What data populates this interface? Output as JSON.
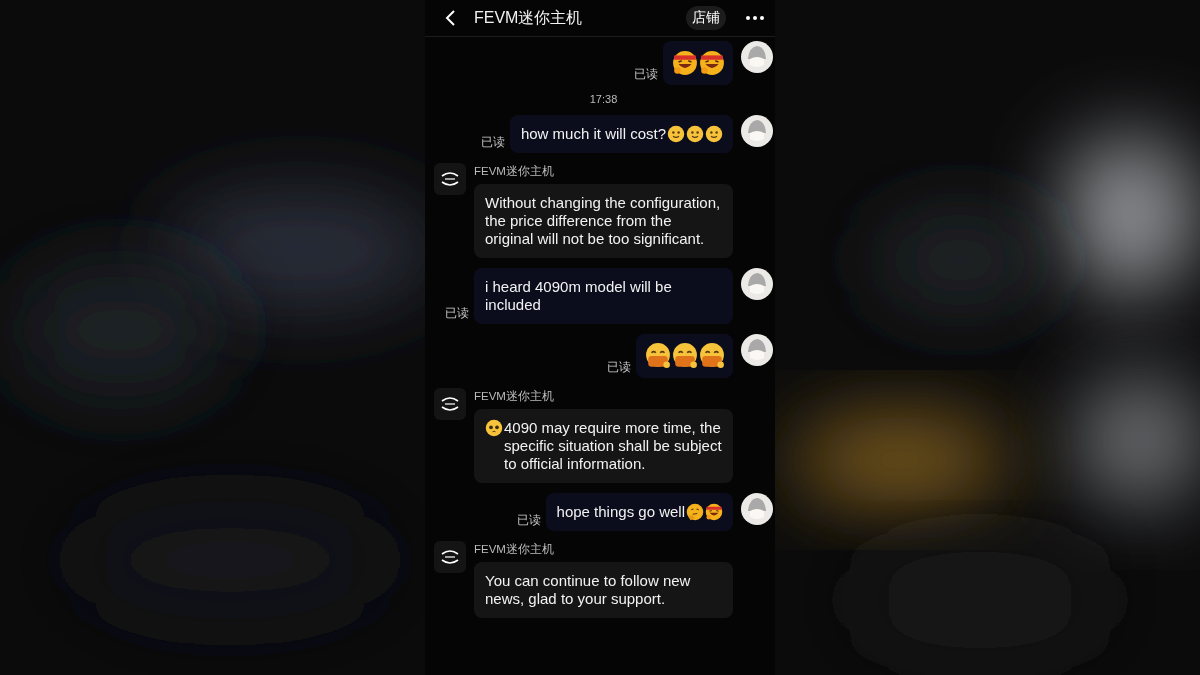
{
  "header": {
    "title": "FEVM迷你主机",
    "shop_button": "店铺"
  },
  "messages": [
    {
      "kind": "outgoing",
      "emojis": [
        {
          "kind": "headband"
        },
        {
          "kind": "headband"
        }
      ],
      "status": "已读"
    },
    {
      "kind": "time",
      "text": "17:38"
    },
    {
      "kind": "outgoing",
      "text": "how much it will cost?",
      "emojis": [
        {
          "kind": "smile"
        },
        {
          "kind": "smile"
        },
        {
          "kind": "smile"
        }
      ],
      "status": "已读"
    },
    {
      "kind": "incoming",
      "sender": "FEVM迷你主机",
      "text": "Without changing the configuration, the price difference from the original will not be too significant."
    },
    {
      "kind": "outgoing",
      "text": "i heard 4090m model will be included",
      "status": "已读"
    },
    {
      "kind": "outgoing",
      "emojis": [
        {
          "kind": "covering"
        },
        {
          "kind": "covering"
        },
        {
          "kind": "covering"
        }
      ],
      "status": "已读"
    },
    {
      "kind": "incoming",
      "sender": "FEVM迷你主机",
      "lead_emojis": [
        {
          "kind": "pleading"
        }
      ],
      "text": "4090 may require more time, the specific situation shall be subject to official information."
    },
    {
      "kind": "outgoing",
      "text": "hope things go well",
      "emojis": [
        {
          "kind": "thinking"
        },
        {
          "kind": "headband"
        }
      ],
      "status": "已读"
    },
    {
      "kind": "incoming",
      "sender": "FEVM迷你主机",
      "text": "You can continue to follow new news, glad to your support."
    }
  ]
}
